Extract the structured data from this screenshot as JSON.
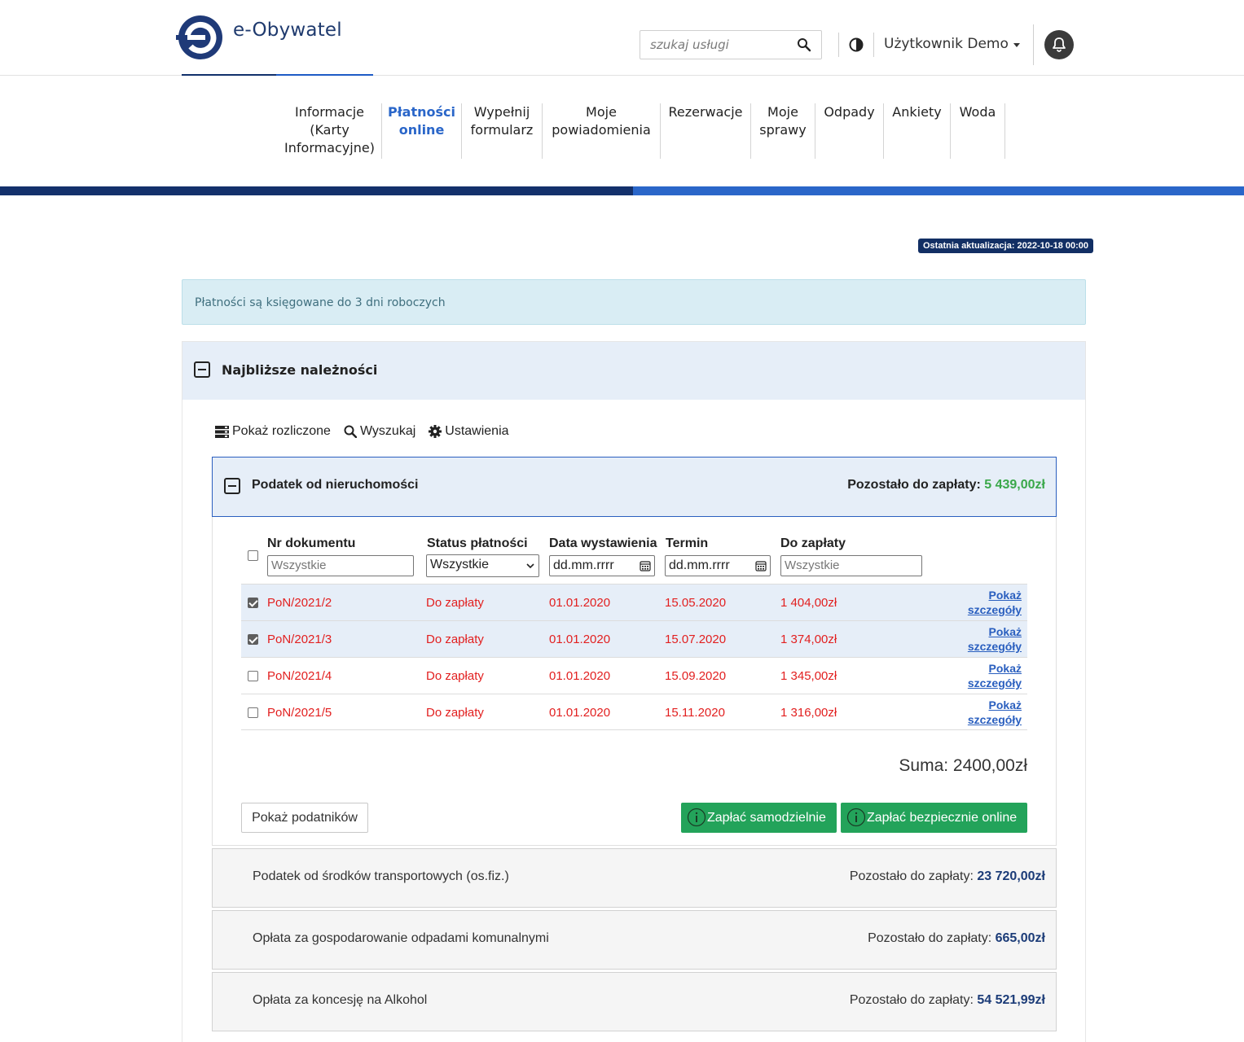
{
  "header": {
    "logo_text": "e-Obywatel",
    "search_placeholder": "szukaj usługi",
    "user_name": "Użytkownik Demo"
  },
  "nav": [
    {
      "label": "Informacje (Karty Informacyjne)",
      "active": false
    },
    {
      "label": "Płatności online",
      "active": true
    },
    {
      "label": "Wypełnij formularz",
      "active": false
    },
    {
      "label": "Moje powiadomienia",
      "active": false
    },
    {
      "label": "Rezerwacje",
      "active": false
    },
    {
      "label": "Moje sprawy",
      "active": false
    },
    {
      "label": "Odpady",
      "active": false
    },
    {
      "label": "Ankiety",
      "active": false
    },
    {
      "label": "Woda",
      "active": false
    }
  ],
  "last_update": "Ostatnia aktualizacja: 2022-10-18 00:00",
  "info_alert": "Płatności są księgowane do 3 dni roboczych",
  "section": {
    "title": "Najbliższe należności",
    "toolbar": {
      "show_settled": "Pokaż rozliczone",
      "search": "Wyszukaj",
      "settings": "Ustawienia"
    }
  },
  "tax": {
    "title": "Podatek od nieruchomości",
    "remaining_label": "Pozostało do zapłaty:",
    "remaining_value": "5 439,00zł",
    "columns": {
      "doc": "Nr dokumentu",
      "status": "Status płatności",
      "issued": "Data wystawienia",
      "due": "Termin",
      "amount": "Do zapłaty"
    },
    "filters": {
      "doc_placeholder": "Wszystkie",
      "status_value": "Wszystkie",
      "issued_placeholder": "dd.mm.rrrr",
      "due_placeholder": "dd.mm.rrrr",
      "amount_placeholder": "Wszystkie"
    },
    "details_line1": "Pokaż",
    "details_line2": "szczegóły",
    "rows": [
      {
        "doc": "PoN/2021/2",
        "status": "Do zapłaty",
        "issued": "01.01.2020",
        "due": "15.05.2020",
        "amount": "1 404,00zł",
        "checked": true
      },
      {
        "doc": "PoN/2021/3",
        "status": "Do zapłaty",
        "issued": "01.01.2020",
        "due": "15.07.2020",
        "amount": "1 374,00zł",
        "checked": true
      },
      {
        "doc": "PoN/2021/4",
        "status": "Do zapłaty",
        "issued": "01.01.2020",
        "due": "15.09.2020",
        "amount": "1 345,00zł",
        "checked": false
      },
      {
        "doc": "PoN/2021/5",
        "status": "Do zapłaty",
        "issued": "01.01.2020",
        "due": "15.11.2020",
        "amount": "1 316,00zł",
        "checked": false
      }
    ],
    "sum": "Suma: 2400,00zł",
    "btn_taxpayers": "Pokaż podatników",
    "btn_pay_self": "Zapłać samodzielnie",
    "btn_pay_online": "Zapłać bezpiecznie online"
  },
  "other_taxes": [
    {
      "name": "Podatek od środków transportowych (os.fiz.)",
      "remaining_label": "Pozostało do zapłaty:",
      "remaining_value": "23 720,00zł"
    },
    {
      "name": "Opłata za gospodarowanie odpadami komunalnymi",
      "remaining_label": "Pozostało do zapłaty:",
      "remaining_value": "665,00zł"
    },
    {
      "name": "Opłata za koncesję na Alkohol",
      "remaining_label": "Pozostało do zapłaty:",
      "remaining_value": "54 521,99zł"
    }
  ],
  "colors": {
    "brand_dark": "#13306b",
    "brand": "#2a66c9",
    "due_red": "#e21f1f",
    "pay_green": "#23a35a",
    "remaining_green": "#3aa84a"
  },
  "icons": [
    "e-logo-icon",
    "search-icon",
    "contrast-icon",
    "bell-icon",
    "minus-square-icon",
    "server-icon",
    "magnifier-icon",
    "gear-icon",
    "calendar-icon",
    "info-circle-icon"
  ]
}
